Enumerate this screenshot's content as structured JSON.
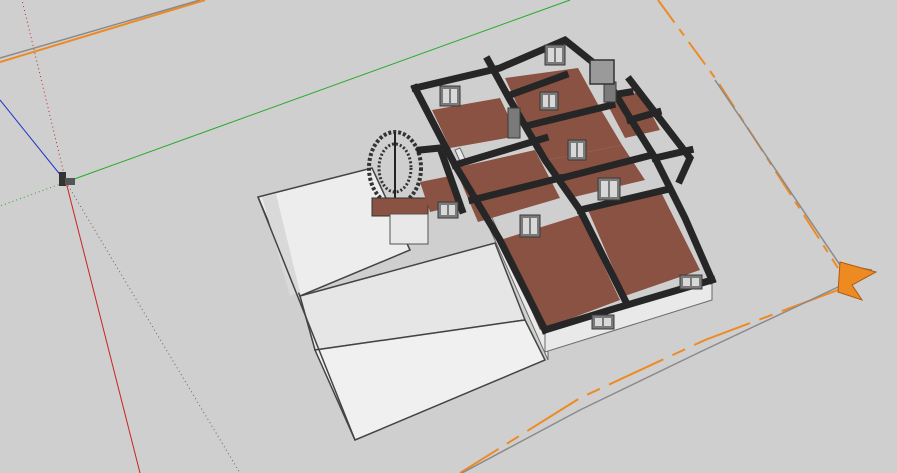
{
  "viewport": {
    "background": "#cfcfcf",
    "axis_colors": {
      "red": "#cc2222",
      "green": "#22aa22",
      "blue": "#2233cc"
    },
    "section_plane_color": "#ee8a22",
    "floor_color": "#8a5243",
    "wall_color": "#262626"
  },
  "scene": {
    "model": "house-floor-plan",
    "icons": [
      "figure-icon",
      "spiral-staircase-icon",
      "section-plane-arrow-icon"
    ]
  }
}
